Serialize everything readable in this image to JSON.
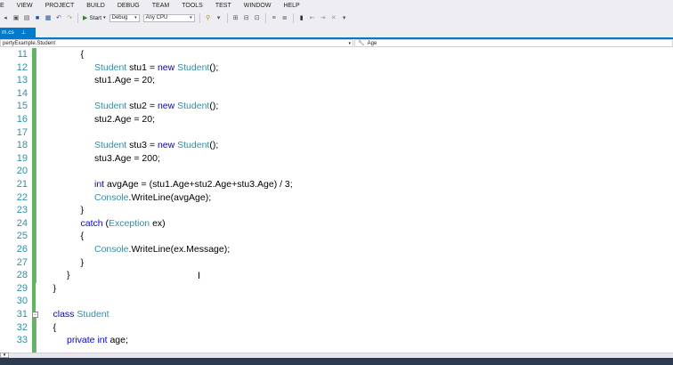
{
  "menu": [
    "E",
    "VIEW",
    "PROJECT",
    "BUILD",
    "DEBUG",
    "TEAM",
    "TOOLS",
    "TEST",
    "WINDOW",
    "HELP"
  ],
  "toolbar": {
    "start_label": "Start",
    "config_value": "Debug",
    "platform_value": "Any CPU"
  },
  "tab": {
    "label": "m.cs",
    "pin": "⊥"
  },
  "nav": {
    "left_value": "pertyExample.Student",
    "right_value": "Age"
  },
  "code_lines": [
    {
      "num": "11",
      "tokens": [
        {
          "t": "{",
          "c": "pl"
        }
      ],
      "indent": 3
    },
    {
      "num": "12",
      "tokens": [
        {
          "t": "Student",
          "c": "ty"
        },
        {
          "t": " stu1 = ",
          "c": "pl"
        },
        {
          "t": "new",
          "c": "kw"
        },
        {
          "t": " ",
          "c": "pl"
        },
        {
          "t": "Student",
          "c": "ty"
        },
        {
          "t": "();",
          "c": "pl"
        }
      ],
      "indent": 4
    },
    {
      "num": "13",
      "tokens": [
        {
          "t": "stu1.Age = 20;",
          "c": "pl"
        }
      ],
      "indent": 4
    },
    {
      "num": "14",
      "tokens": [],
      "indent": 0
    },
    {
      "num": "15",
      "tokens": [
        {
          "t": "Student",
          "c": "ty"
        },
        {
          "t": " stu2 = ",
          "c": "pl"
        },
        {
          "t": "new",
          "c": "kw"
        },
        {
          "t": " ",
          "c": "pl"
        },
        {
          "t": "Student",
          "c": "ty"
        },
        {
          "t": "();",
          "c": "pl"
        }
      ],
      "indent": 4
    },
    {
      "num": "16",
      "tokens": [
        {
          "t": "stu2.Age = 20;",
          "c": "pl"
        }
      ],
      "indent": 4
    },
    {
      "num": "17",
      "tokens": [],
      "indent": 0
    },
    {
      "num": "18",
      "tokens": [
        {
          "t": "Student",
          "c": "ty"
        },
        {
          "t": " stu3 = ",
          "c": "pl"
        },
        {
          "t": "new",
          "c": "kw"
        },
        {
          "t": " ",
          "c": "pl"
        },
        {
          "t": "Student",
          "c": "ty"
        },
        {
          "t": "();",
          "c": "pl"
        }
      ],
      "indent": 4
    },
    {
      "num": "19",
      "tokens": [
        {
          "t": "stu3.Age = 200;",
          "c": "pl"
        }
      ],
      "indent": 4
    },
    {
      "num": "20",
      "tokens": [],
      "indent": 0
    },
    {
      "num": "21",
      "tokens": [
        {
          "t": "int",
          "c": "kw"
        },
        {
          "t": " avgAge = (stu1.Age+stu2.Age+stu3.Age) / 3;",
          "c": "pl"
        }
      ],
      "indent": 4
    },
    {
      "num": "22",
      "tokens": [
        {
          "t": "Console",
          "c": "ty"
        },
        {
          "t": ".WriteLine(avgAge);",
          "c": "pl"
        }
      ],
      "indent": 4
    },
    {
      "num": "23",
      "tokens": [
        {
          "t": "}",
          "c": "pl"
        }
      ],
      "indent": 3
    },
    {
      "num": "24",
      "tokens": [
        {
          "t": "catch",
          "c": "kw"
        },
        {
          "t": " (",
          "c": "pl"
        },
        {
          "t": "Exception",
          "c": "ty"
        },
        {
          "t": " ex)",
          "c": "pl"
        }
      ],
      "indent": 3
    },
    {
      "num": "25",
      "tokens": [
        {
          "t": "{",
          "c": "pl"
        }
      ],
      "indent": 3
    },
    {
      "num": "26",
      "tokens": [
        {
          "t": "Console",
          "c": "ty"
        },
        {
          "t": ".WriteLine(ex.Message);",
          "c": "pl"
        }
      ],
      "indent": 4
    },
    {
      "num": "27",
      "tokens": [
        {
          "t": "}",
          "c": "pl"
        }
      ],
      "indent": 3
    },
    {
      "num": "28",
      "tokens": [
        {
          "t": "}",
          "c": "pl"
        }
      ],
      "indent": 2
    },
    {
      "num": "29",
      "tokens": [
        {
          "t": "}",
          "c": "pl"
        }
      ],
      "indent": 1
    },
    {
      "num": "30",
      "tokens": [],
      "indent": 0
    },
    {
      "num": "31",
      "tokens": [
        {
          "t": "class",
          "c": "kw"
        },
        {
          "t": " ",
          "c": "pl"
        },
        {
          "t": "Student",
          "c": "ty"
        }
      ],
      "indent": 1,
      "collapse": "−"
    },
    {
      "num": "32",
      "tokens": [
        {
          "t": "{",
          "c": "pl"
        }
      ],
      "indent": 1
    },
    {
      "num": "33",
      "tokens": [
        {
          "t": "private",
          "c": "kw"
        },
        {
          "t": " ",
          "c": "pl"
        },
        {
          "t": "int",
          "c": "kw"
        },
        {
          "t": " age;",
          "c": "pl"
        }
      ],
      "indent": 2
    }
  ],
  "colors": {
    "keyword": "#0000ff",
    "type": "#2b91af",
    "line_number": "#2b91af",
    "change_bar": "#5cb85c",
    "accent": "#007acc"
  },
  "icons": [
    "new-project-icon",
    "open-icon",
    "save-icon",
    "save-all-icon",
    "undo-icon",
    "redo-icon",
    "play-icon",
    "find-icon",
    "bookmark-icon",
    "comment-icon",
    "collapse-icon",
    "ibeam-cursor-icon"
  ]
}
